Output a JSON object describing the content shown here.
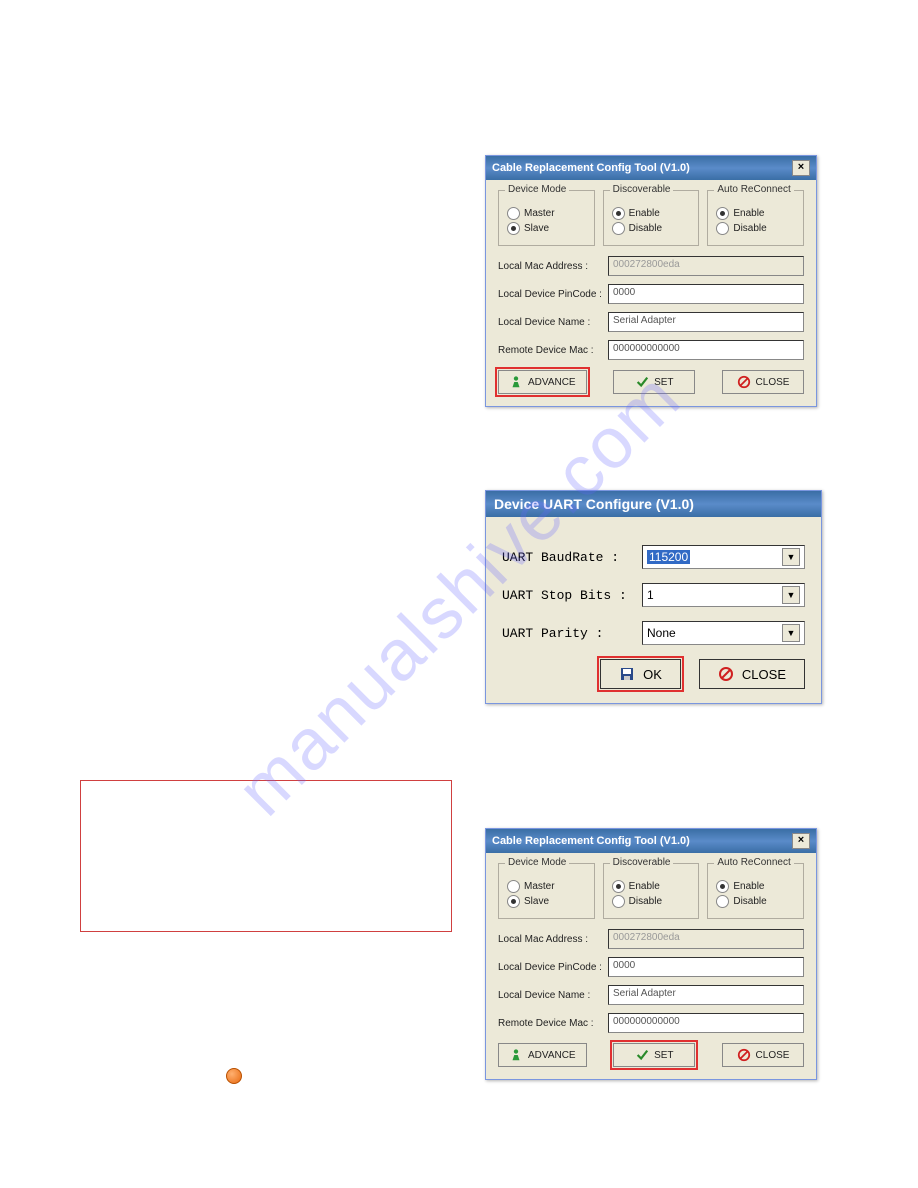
{
  "watermark": "manualshive.com",
  "dialog1": {
    "title": "Cable Replacement Config Tool (V1.0)",
    "groups": {
      "device_mode": {
        "legend": "Device Mode",
        "opt1": "Master",
        "opt2": "Slave",
        "selected": "Slave"
      },
      "discoverable": {
        "legend": "Discoverable",
        "opt1": "Enable",
        "opt2": "Disable",
        "selected": "Enable"
      },
      "auto_reconnect": {
        "legend": "Auto ReConnect",
        "opt1": "Enable",
        "opt2": "Disable",
        "selected": "Enable"
      }
    },
    "fields": {
      "mac_label": "Local Mac Address :",
      "mac_value": "000272800eda",
      "pin_label": "Local Device PinCode :",
      "pin_value": "0000",
      "name_label": "Local Device Name :",
      "name_value": "Serial Adapter",
      "remote_label": "Remote Device Mac :",
      "remote_value": "000000000000"
    },
    "buttons": {
      "advance": "ADVANCE",
      "set": "SET",
      "close": "CLOSE"
    }
  },
  "uart": {
    "title": "Device UART Configure (V1.0)",
    "rows": {
      "baud_label": "UART BaudRate :",
      "baud_value": "115200",
      "stop_label": "UART Stop Bits :",
      "stop_value": "1",
      "parity_label": "UART Parity :",
      "parity_value": "None"
    },
    "buttons": {
      "ok": "OK",
      "close": "CLOSE"
    }
  },
  "dialog2": {
    "title": "Cable Replacement Config Tool (V1.0)",
    "groups": {
      "device_mode": {
        "legend": "Device Mode",
        "opt1": "Master",
        "opt2": "Slave",
        "selected": "Slave"
      },
      "discoverable": {
        "legend": "Discoverable",
        "opt1": "Enable",
        "opt2": "Disable",
        "selected": "Enable"
      },
      "auto_reconnect": {
        "legend": "Auto ReConnect",
        "opt1": "Enable",
        "opt2": "Disable",
        "selected": "Enable"
      }
    },
    "fields": {
      "mac_label": "Local Mac Address :",
      "mac_value": "000272800eda",
      "pin_label": "Local Device PinCode :",
      "pin_value": "0000",
      "name_label": "Local Device Name :",
      "name_value": "Serial Adapter",
      "remote_label": "Remote Device Mac :",
      "remote_value": "000000000000"
    },
    "buttons": {
      "advance": "ADVANCE",
      "set": "SET",
      "close": "CLOSE"
    }
  }
}
